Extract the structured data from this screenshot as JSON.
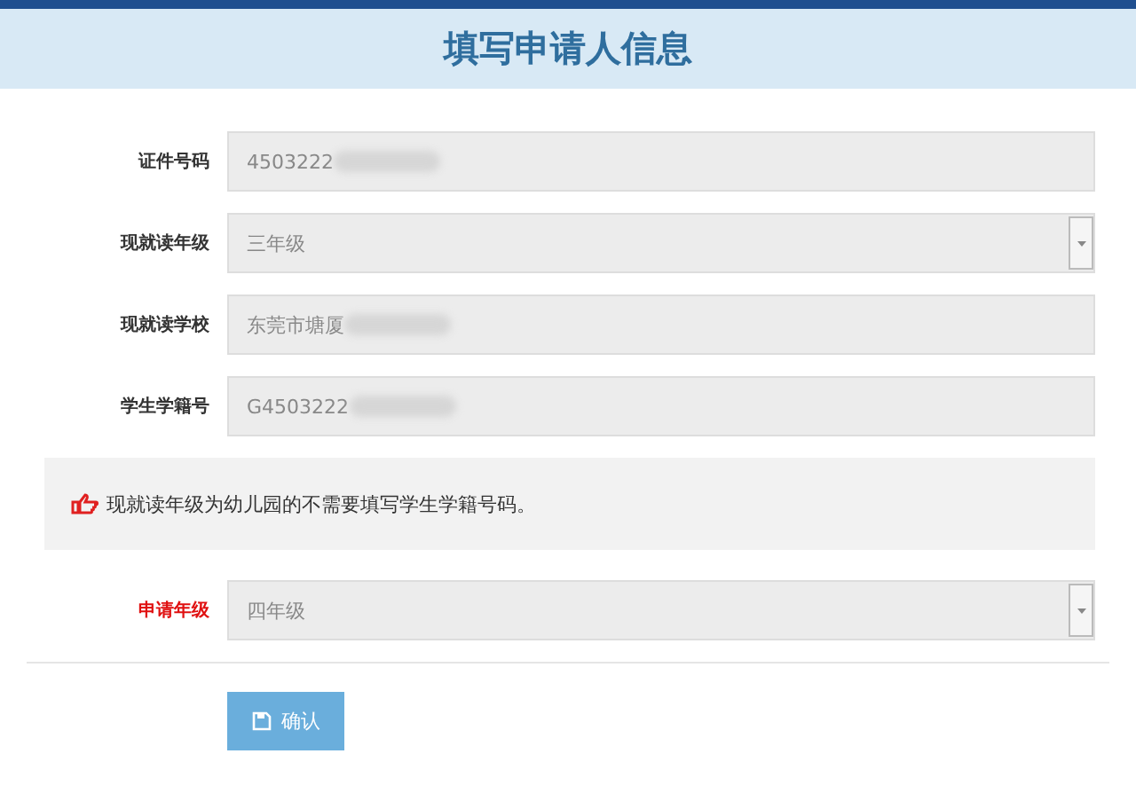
{
  "dialog": {
    "title": "填写申请人信息"
  },
  "fields": [
    {
      "label": "证件号码",
      "kind": "text",
      "value": "4503222",
      "required": false,
      "blurred": true
    },
    {
      "label": "现就读年级",
      "kind": "select",
      "value": "三年级",
      "required": false,
      "blurred": false
    },
    {
      "label": "现就读学校",
      "kind": "text",
      "value": "东莞市塘厦",
      "required": false,
      "blurred": true
    },
    {
      "label": "学生学籍号",
      "kind": "text",
      "value": "G4503222",
      "required": false,
      "blurred": true
    }
  ],
  "notice": "现就读年级为幼儿园的不需要填写学生学籍号码。",
  "grade_field": {
    "label": "申请年级",
    "kind": "select",
    "value": "四年级",
    "required": true,
    "blurred": false
  },
  "confirm_button": {
    "label": "确认"
  }
}
